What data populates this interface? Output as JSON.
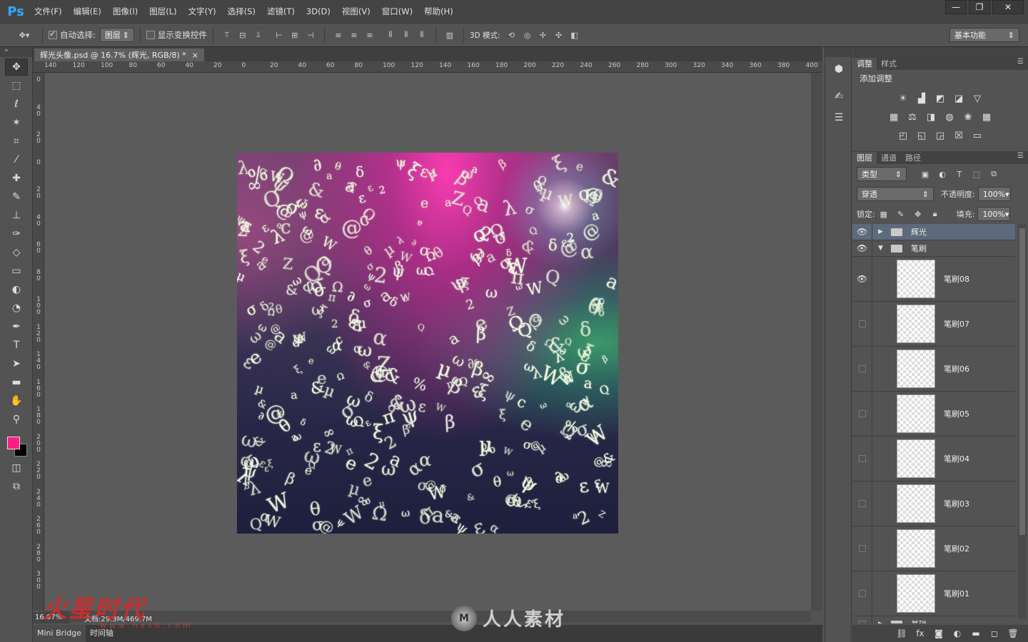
{
  "app": {
    "logo": "Ps",
    "menu": [
      "文件(F)",
      "编辑(E)",
      "图像(I)",
      "图层(L)",
      "文字(Y)",
      "选择(S)",
      "滤镜(T)",
      "3D(D)",
      "视图(V)",
      "窗口(W)",
      "帮助(H)"
    ],
    "window_controls": [
      "—",
      "❐",
      "✕"
    ]
  },
  "options": {
    "auto_select_label": "自动选择:",
    "auto_select_value": "图层",
    "show_transform_label": "显示变换控件",
    "mode_3d_label": "3D 模式:",
    "workspace": "基本功能"
  },
  "document": {
    "tab_title": "辉光头像.psd @ 16.7% (辉光, RGB/8) *",
    "tab_close": "×",
    "ruler_top": [
      "140",
      "120",
      "100",
      "80",
      "60",
      "40",
      "20",
      "0",
      "20",
      "40",
      "60",
      "80",
      "100",
      "120",
      "140",
      "160",
      "180",
      "200",
      "220",
      "240",
      "260",
      "280",
      "300",
      "320",
      "340",
      "360",
      "380",
      "400"
    ],
    "ruler_left": [
      "0",
      "4\n0",
      "2\n0",
      "0",
      "2\n0",
      "4\n0",
      "6\n0",
      "8\n0",
      "1\n0\n0",
      "1\n2\n0",
      "1\n4\n0",
      "1\n6\n0",
      "1\n8\n0",
      "2\n0\n0",
      "2\n2\n0",
      "2\n4\n0",
      "2\n6\n0",
      "2\n8\n0",
      "3\n0\n0"
    ],
    "zoom": "16.67%",
    "doc_info": "文档:29.3M/469.7M"
  },
  "colors": {
    "foreground": "#ff1f86",
    "background": "#000000"
  },
  "bottom_tabs": [
    "Mini Bridge",
    "时间轴"
  ],
  "watermarks": {
    "left": "火星时代",
    "left_sub": "www.hxsd.com",
    "center_logo": "M",
    "center": "人人素材"
  },
  "adjustments": {
    "tabs": [
      "调整",
      "样式"
    ],
    "title": "添加调整",
    "rows": [
      [
        "brightness-icon",
        "levels-icon",
        "curves-icon",
        "exposure-icon",
        "triangle-icon"
      ],
      [
        "vibrance-icon",
        "balance-icon",
        "bw-icon",
        "photo-filter-icon",
        "channel-mixer-icon",
        "lookup-icon"
      ],
      [
        "invert-icon",
        "posterize-icon",
        "threshold-icon",
        "selective-color-icon",
        "gradient-map-icon"
      ]
    ]
  },
  "layers": {
    "tabs": [
      "图层",
      "通道",
      "路径"
    ],
    "filter_type": "类型",
    "blend_mode": "穿透",
    "opacity_label": "不透明度:",
    "opacity_value": "100%",
    "lock_label": "锁定:",
    "fill_label": "填充:",
    "fill_value": "100%",
    "items": [
      {
        "name": "辉光",
        "kind": "group",
        "expanded": false,
        "visible": true,
        "selected": true
      },
      {
        "name": "笔刷",
        "kind": "group",
        "expanded": true,
        "visible": true,
        "selected": false
      },
      {
        "name": "笔刷08",
        "kind": "layer",
        "visible": true
      },
      {
        "name": "笔刷07",
        "kind": "layer",
        "visible": false
      },
      {
        "name": "笔刷06",
        "kind": "layer",
        "visible": false
      },
      {
        "name": "笔刷05",
        "kind": "layer",
        "visible": false
      },
      {
        "name": "笔刷04",
        "kind": "layer",
        "visible": false
      },
      {
        "name": "笔刷03",
        "kind": "layer",
        "visible": false
      },
      {
        "name": "笔刷02",
        "kind": "layer",
        "visible": false
      },
      {
        "name": "笔刷01",
        "kind": "layer",
        "visible": false
      },
      {
        "name": "基础",
        "kind": "group",
        "expanded": false,
        "visible": false
      }
    ]
  }
}
